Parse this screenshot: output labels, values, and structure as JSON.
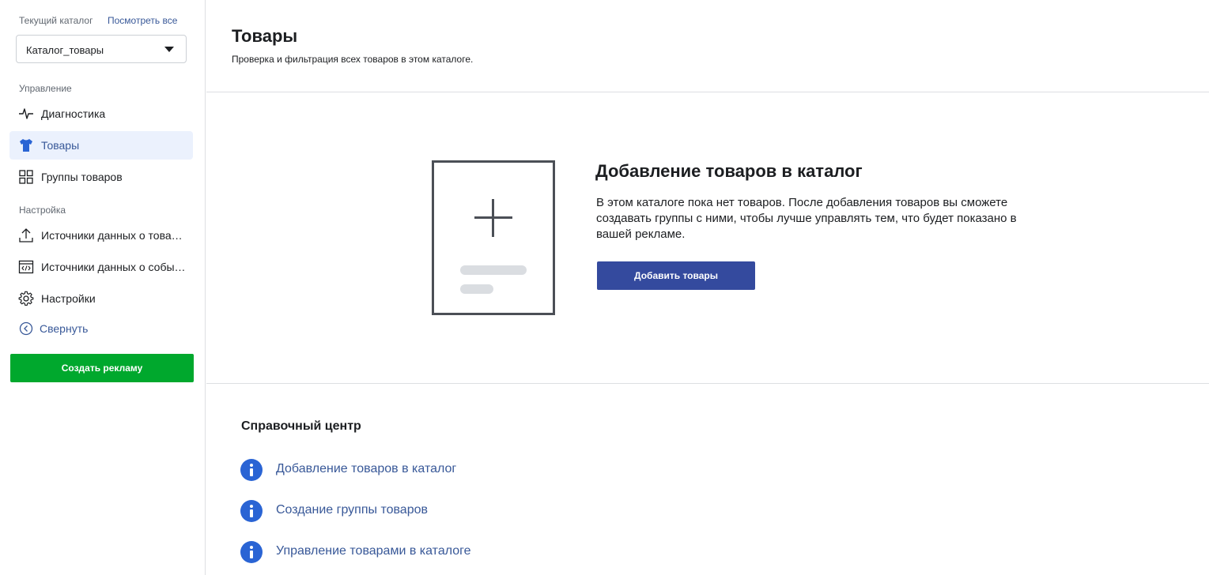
{
  "sidebar": {
    "current_catalog_label": "Текущий каталог",
    "view_all": "Посмотреть все",
    "catalog_select_value": "Каталог_товары",
    "section_manage": "Управление",
    "section_settings": "Настройка",
    "items": [
      {
        "label": "Диагностика",
        "icon": "pulse-icon"
      },
      {
        "label": "Товары",
        "icon": "tshirt-icon",
        "active": true
      },
      {
        "label": "Группы товаров",
        "icon": "grid-icon"
      },
      {
        "label": "Источники данных о товарах",
        "icon": "upload-icon"
      },
      {
        "label": "Источники данных о событиях",
        "icon": "code-window-icon"
      },
      {
        "label": "Настройки",
        "icon": "gear-icon"
      }
    ],
    "collapse_label": "Свернуть",
    "create_ad_button": "Создать рекламу"
  },
  "main": {
    "title": "Товары",
    "subtitle": "Проверка и фильтрация всех товаров в этом каталоге.",
    "empty_state": {
      "title": "Добавление товаров в каталог",
      "text": "В этом каталоге пока нет товаров. После добавления товаров вы сможете создавать группы с ними, чтобы лучше управлять тем, что будет показано в вашей рекламе.",
      "button": "Добавить товары"
    },
    "help": {
      "title": "Справочный центр",
      "links": [
        "Добавление товаров в каталог",
        "Создание группы товаров",
        "Управление товарами в каталоге"
      ]
    }
  },
  "colors": {
    "accent_blue": "#385898",
    "primary_button": "#344a9e",
    "create_ad_green": "#00a82d",
    "info_icon_blue": "#2a64d4",
    "active_item_bg": "#ebf1fd"
  }
}
